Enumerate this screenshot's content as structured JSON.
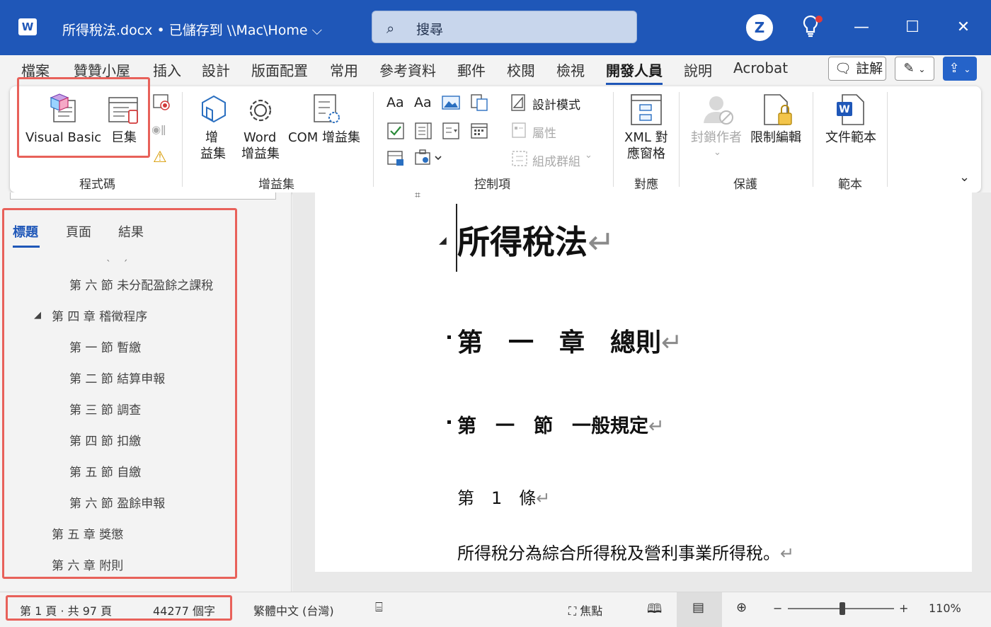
{
  "titlebar": {
    "app_icon": "W",
    "doc_title": "所得稅法.docx • 已儲存到 \\\\Mac\\Home ⌵",
    "search_placeholder": "搜尋",
    "profile_icon": "Z"
  },
  "tabs": [
    "檔案",
    "贊贊小屋",
    "插入",
    "設計",
    "版面配置",
    "常用",
    "參考資料",
    "郵件",
    "校閱",
    "檢視",
    "開發人員",
    "說明",
    "Acrobat"
  ],
  "active_tab": "開發人員",
  "right_buttons": {
    "comment": "註解"
  },
  "ribbon": {
    "groups": {
      "code": "程式碼",
      "addins": "增益集",
      "controls": "控制項",
      "mapping": "對應",
      "protect": "保護",
      "templates": "範本"
    },
    "buttons": {
      "visual_basic": "Visual Basic",
      "macros": "巨集",
      "addins_l1": "增",
      "addins_l2": "益集",
      "word_addins_l1": "Word",
      "word_addins_l2": "增益集",
      "com_addins": "COM 增益集",
      "design_mode": "設計模式",
      "properties": "屬性",
      "group": "組成群組",
      "xml_l1": "XML 對",
      "xml_l2": "應窗格",
      "block_authors": "封鎖作者",
      "restrict_editing": "限制編輯",
      "document_template": "文件範本",
      "aa1": "Aa",
      "aa2": "Aa"
    }
  },
  "navpane": {
    "tabs": [
      "標題",
      "頁面",
      "結果"
    ],
    "items": [
      "第 六 節 未分配盈餘之課稅",
      "第 四 章 稽徵程序",
      "第 一 節 暫繳",
      "第 二 節 結算申報",
      "第 三 節 調查",
      "第 四 節 扣繳",
      "第 五 節 自繳",
      "第 六 節 盈餘申報",
      "第 五 章 獎懲",
      "第 六 章 附則"
    ]
  },
  "document": {
    "title": "所得稅法",
    "chapter": "第　一　章　總則",
    "section": "第　一　節　一般規定",
    "article": "第　1　條",
    "paragraph": "所得稅分為綜合所得稅及營利事業所得稅。",
    "pilcrow": "↵"
  },
  "statusbar": {
    "page": "第 1 頁 · 共 97 頁",
    "words": "44277 個字",
    "language": "繁體中文 (台灣)",
    "focus": "焦點",
    "zoom": "110%",
    "zoom_minus": "−",
    "zoom_plus": "+"
  },
  "colors": {
    "titlebar": "#1f57b8",
    "highlight_box": "#e8615a",
    "accent": "#1f57b8"
  }
}
